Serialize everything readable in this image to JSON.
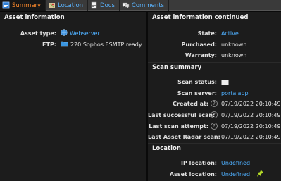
{
  "tabs": [
    {
      "label": "Summary",
      "icon": "summary-icon",
      "active": true
    },
    {
      "label": "Location",
      "icon": "location-icon",
      "active": false
    },
    {
      "label": "Docs",
      "icon": "docs-icon",
      "active": false
    },
    {
      "label": "Comments",
      "icon": "comments-icon",
      "active": false
    }
  ],
  "left": {
    "title": "Asset information",
    "asset_type_label": "Asset type:",
    "asset_type_value": "Webserver",
    "ftp_label": "FTP:",
    "ftp_value": "220 Sophos ESMTP ready"
  },
  "right": {
    "title": "Asset information continued",
    "state_label": "State:",
    "state_value": "Active",
    "purchased_label": "Purchased:",
    "purchased_value": "unknown",
    "warranty_label": "Warranty:",
    "warranty_value": "unknown",
    "scan_title": "Scan summary",
    "scan_status_label": "Scan status:",
    "scan_server_label": "Scan server:",
    "scan_server_value": "portalapp",
    "created_label": "Created at:",
    "created_value": "07/19/2022 20:10:49",
    "last_success_label": "Last successful scan:",
    "last_success_value": "07/19/2022 20:10:49",
    "last_attempt_label": "Last scan attempt:",
    "last_attempt_value": "07/19/2022 20:10:49",
    "last_radar_label": "Last Asset Radar scan:",
    "last_radar_value": "07/19/2022 20:10:49",
    "location_title": "Location",
    "ip_location_label": "IP location:",
    "ip_location_value": "Undefined",
    "asset_location_label": "Asset location:",
    "asset_location_value": "Undefined"
  },
  "colors": {
    "accent": "#ff8a2b",
    "link": "#4fb0ff",
    "panel": "#1c1c1c"
  }
}
